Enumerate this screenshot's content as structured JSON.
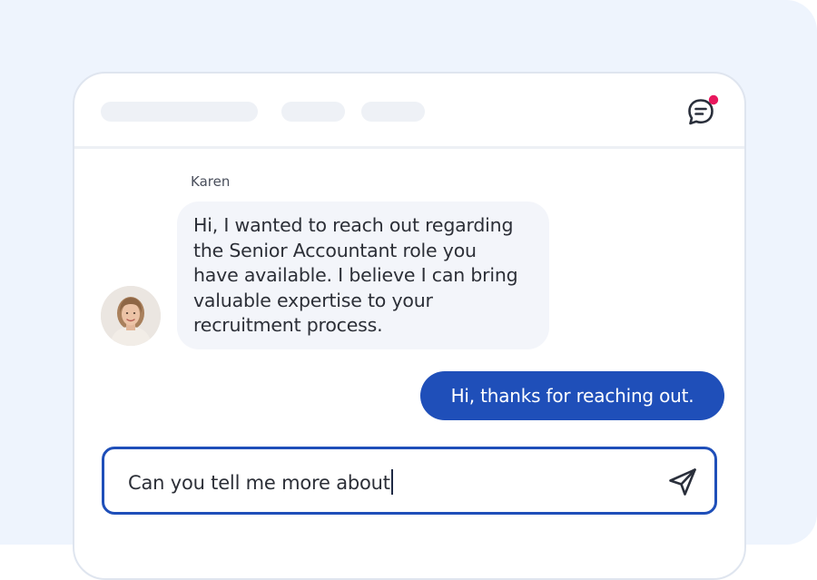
{
  "colors": {
    "backdrop": "#eef4fd",
    "accent": "#1f4fb9",
    "notification_dot": "#e8175d",
    "incoming_bubble": "#f3f5fa"
  },
  "header": {
    "icon": "chat-bubble-icon",
    "has_notification": true
  },
  "conversation": {
    "incoming": {
      "sender": "Karen",
      "avatar": "avatar-karen",
      "lines": [
        "Hi, I wanted to reach out regarding",
        "the Senior Accountant role you",
        "have available. I believe I can bring",
        "valuable expertise to your",
        "recruitment process."
      ]
    },
    "outgoing": {
      "text": "Hi, thanks for reaching out."
    }
  },
  "composer": {
    "value": "Can you tell me more about",
    "send_icon": "send-icon"
  }
}
